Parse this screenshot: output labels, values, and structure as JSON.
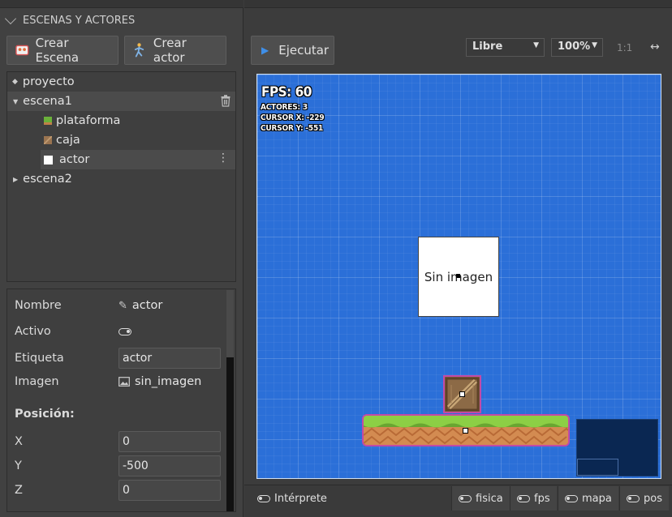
{
  "left_panel": {
    "section_title": "ESCENAS Y ACTORES",
    "create_scene_label": "Crear Escena",
    "create_actor_label": "Crear actor"
  },
  "tree": {
    "project": "proyecto",
    "scene1": "escena1",
    "plataforma": "plataforma",
    "caja": "caja",
    "actor": "actor",
    "scene2": "escena2"
  },
  "properties": {
    "name_label": "Nombre",
    "name_value": "actor",
    "active_label": "Activo",
    "tag_label": "Etiqueta",
    "tag_value": "actor",
    "image_label": "Imagen",
    "image_value": "sin_imagen",
    "position_heading": "Posición:",
    "x_label": "X",
    "x_value": "0",
    "y_label": "Y",
    "y_value": "-500",
    "z_label": "Z",
    "z_value": "0"
  },
  "toolbar": {
    "run_label": "Ejecutar",
    "camera_mode": "Libre",
    "zoom": "100%",
    "ratio": "1:1"
  },
  "hud": {
    "fps": "FPS: 60",
    "actors": "ACTORES: 3",
    "cursor_x": "CURSOR X: -229",
    "cursor_y": "CURSOR Y: -551"
  },
  "canvas": {
    "actor_placeholder": "Sin imagen"
  },
  "bottom": {
    "interpreter": "Intérprete",
    "fisica": "fisica",
    "fps": "fps",
    "mapa": "mapa",
    "pos": "pos"
  },
  "colors": {
    "canvas_bg": "#2b6fd8",
    "selection_outline": "#c24aa6",
    "run_accent": "#3f8fe8"
  }
}
